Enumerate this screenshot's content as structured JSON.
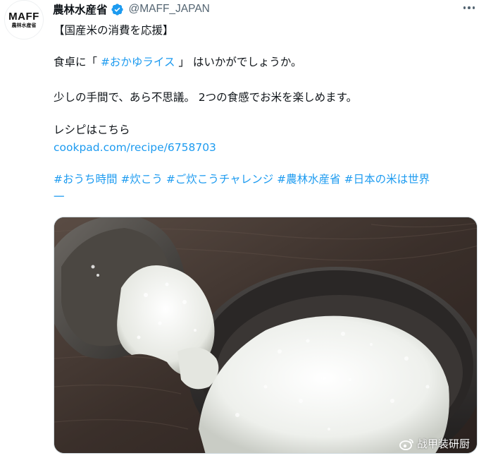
{
  "account": {
    "avatar_logo_main": "MAFF",
    "avatar_logo_sub": "農林水産省",
    "display_name": "農林水産省",
    "handle": "@MAFF_JAPAN"
  },
  "tweet": {
    "line1": "【国産米の消費を応援】",
    "line2_prefix": "食卓に「 ",
    "line2_hashtag": "#おかゆライス",
    "line2_suffix": " 」 はいかがでしょうか。",
    "line3": "少しの手間で、あら不思議。 2つの食感でお米を楽しめます。",
    "line4": "レシピはこちら",
    "recipe_link": "cookpad.com/recipe/6758703",
    "hashtags": [
      "#おうち時間",
      "#炊こう",
      "#ご炊こうチャレンジ",
      "#農林水産省",
      "#日本の米は世界"
    ],
    "hashtag_continuation": "一"
  },
  "watermark": {
    "text": "战甲装研厨"
  },
  "colors": {
    "link": "#1d9bf0",
    "handle": "#536471",
    "verified": "#1d9bf0"
  },
  "icons": [
    "verified-badge-icon",
    "more-options-icon",
    "weibo-icon"
  ]
}
